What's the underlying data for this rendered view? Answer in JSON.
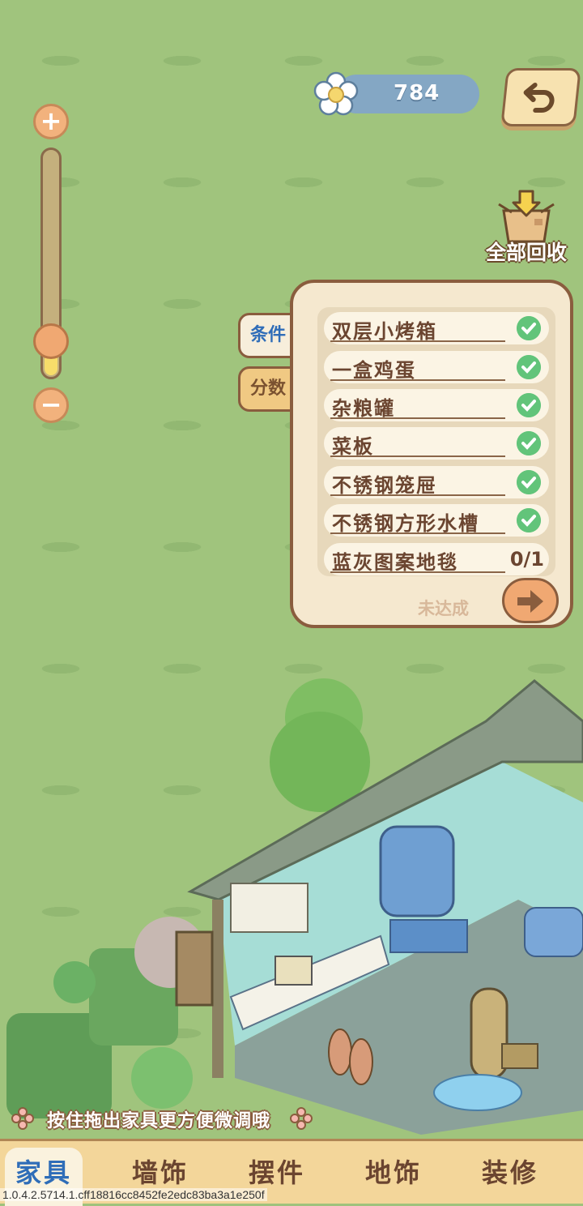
{
  "currency": {
    "value": "784",
    "icon": "flower-icon"
  },
  "top_right": {
    "back_icon": "undo-arrow-icon"
  },
  "recycle_all": {
    "label": "全部回收",
    "icon": "box-arrow-icon"
  },
  "zoom": {
    "plus": "+",
    "minus": "−",
    "level_fraction": 0.15
  },
  "panel": {
    "tabs": [
      {
        "label": "条件",
        "active": true
      },
      {
        "label": "分数",
        "active": false
      }
    ],
    "conditions": [
      {
        "name": "双层小烤箱",
        "done": true
      },
      {
        "name": "一盒鸡蛋",
        "done": true
      },
      {
        "name": "杂粮罐",
        "done": true
      },
      {
        "name": "菜板",
        "done": true
      },
      {
        "name": "不锈钢笼屉",
        "done": true
      },
      {
        "name": "不锈钢方形水槽",
        "done": true
      },
      {
        "name": "蓝灰图案地毯",
        "done": false,
        "progress": "0/1"
      }
    ],
    "status": "未达成",
    "next_icon": "arrow-right-icon"
  },
  "hint": "按住拖出家具更方便微调哦",
  "bottom_tabs": [
    {
      "label": "家具",
      "active": true
    },
    {
      "label": "墙饰",
      "active": false
    },
    {
      "label": "摆件",
      "active": false
    },
    {
      "label": "地饰",
      "active": false
    },
    {
      "label": "装修",
      "active": false
    }
  ],
  "version": "1.0.4.2.5714.1.cff18816cc8452fe2edc83ba3a1e250f",
  "colors": {
    "background": "#a0c47d",
    "panel": "#f5e8cf",
    "accent_blue": "#2f6db8",
    "check_green": "#62c47a"
  }
}
